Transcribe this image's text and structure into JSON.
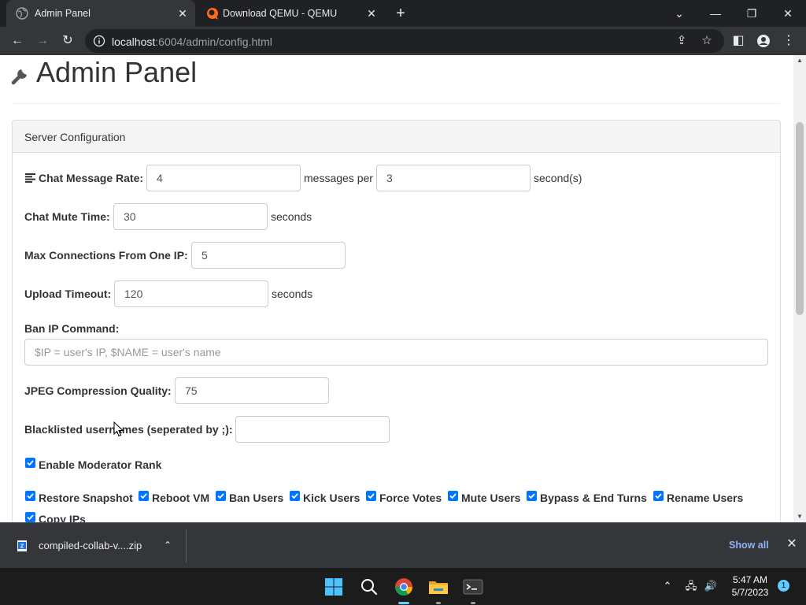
{
  "browser": {
    "tabs": [
      {
        "title": "Admin Panel",
        "active": true
      },
      {
        "title": "Download QEMU - QEMU",
        "active": false
      }
    ],
    "url": {
      "host": "localhost",
      "rest": ":6004/admin/config.html"
    }
  },
  "page": {
    "title": "Admin Panel",
    "panel_title": "Server Configuration",
    "fields": {
      "chat_rate": {
        "label": "Chat Message Rate:",
        "value1": "4",
        "mid_text": "messages per",
        "value2": "3",
        "unit": "second(s)"
      },
      "mute_time": {
        "label": "Chat Mute Time:",
        "value": "30",
        "unit": "seconds"
      },
      "max_conn": {
        "label": "Max Connections From One IP:",
        "value": "5"
      },
      "upload_timeout": {
        "label": "Upload Timeout:",
        "value": "120",
        "unit": "seconds"
      },
      "ban_cmd": {
        "label": "Ban IP Command:",
        "value": "",
        "placeholder": "$IP = user's IP, $NAME = user's name"
      },
      "jpeg_quality": {
        "label": "JPEG Compression Quality:",
        "value": "75"
      },
      "blacklist": {
        "label": "Blacklisted usernames (seperated by ;):",
        "value": ""
      }
    },
    "moderator": {
      "label": "Enable Moderator Rank",
      "checked": true
    },
    "permissions": [
      {
        "label": "Restore Snapshot",
        "checked": true
      },
      {
        "label": "Reboot VM",
        "checked": true
      },
      {
        "label": "Ban Users",
        "checked": true
      },
      {
        "label": "Kick Users",
        "checked": true
      },
      {
        "label": "Force Votes",
        "checked": true
      },
      {
        "label": "Mute Users",
        "checked": true
      },
      {
        "label": "Bypass & End Turns",
        "checked": true
      },
      {
        "label": "Rename Users",
        "checked": true
      },
      {
        "label": "Copy IPs",
        "checked": true
      }
    ]
  },
  "download": {
    "filename": "compiled-collab-v....zip",
    "show_all": "Show all"
  },
  "taskbar": {
    "time": "5:47 AM",
    "date": "5/7/2023",
    "notifications": "1"
  },
  "colors": {
    "checkbox": "#0075ff",
    "taskbar_accent": "#60cdff",
    "link": "#8ab4f8"
  }
}
